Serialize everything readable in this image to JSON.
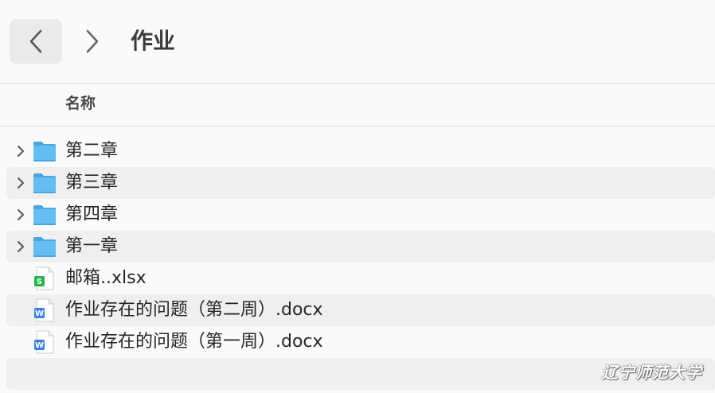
{
  "toolbar": {
    "title": "作业"
  },
  "columns": {
    "name": "名称"
  },
  "files": [
    {
      "name": "第二章",
      "type": "folder",
      "expandable": true
    },
    {
      "name": "第三章",
      "type": "folder",
      "expandable": true
    },
    {
      "name": "第四章",
      "type": "folder",
      "expandable": true
    },
    {
      "name": "第一章",
      "type": "folder",
      "expandable": true
    },
    {
      "name": "邮箱..xlsx",
      "type": "spreadsheet",
      "expandable": false
    },
    {
      "name": "作业存在的问题（第二周）.docx",
      "type": "document",
      "expandable": false
    },
    {
      "name": "作业存在的问题（第一周）.docx",
      "type": "document",
      "expandable": false
    }
  ],
  "watermark": "辽宁师范大学",
  "colors": {
    "folder": "#5fb6ec",
    "spreadsheet": "#22b34d",
    "document": "#3b7fe0",
    "alt_row": "#f0efef"
  }
}
